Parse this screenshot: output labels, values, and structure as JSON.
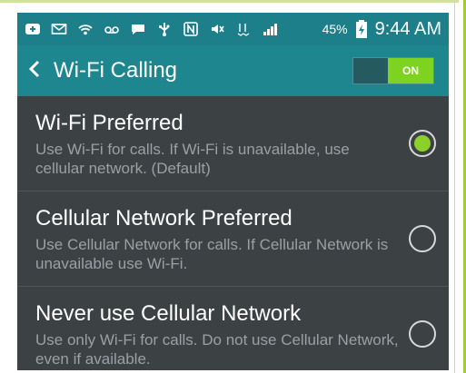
{
  "status_bar": {
    "icons": [
      "add-call-icon",
      "email-icon",
      "wifi-icon",
      "voicemail-icon",
      "chat-icon",
      "usb-icon",
      "nfc-icon",
      "mute-icon",
      "data-4g-icon",
      "signal-icon"
    ],
    "battery_percent": "45%",
    "time": "9:44 AM"
  },
  "action_bar": {
    "title": "Wi-Fi Calling",
    "toggle_label": "ON",
    "toggle_on": true
  },
  "options": [
    {
      "title": "Wi-Fi Preferred",
      "description": "Use Wi-Fi for calls. If Wi-Fi is unavailable, use cellular network. (Default)",
      "selected": true
    },
    {
      "title": "Cellular Network Preferred",
      "description": "Use Cellular Network for calls. If Cellular Network is unavailable use Wi-Fi.",
      "selected": false
    },
    {
      "title": "Never use Cellular Network",
      "description": "Use only Wi-Fi for calls. Do not use Cellular Network, even if available.",
      "selected": false
    }
  ],
  "colors": {
    "status_bar": "#1c7f89",
    "action_bar": "#1e868f",
    "background": "#3c4144",
    "accent": "#8bd12a"
  }
}
